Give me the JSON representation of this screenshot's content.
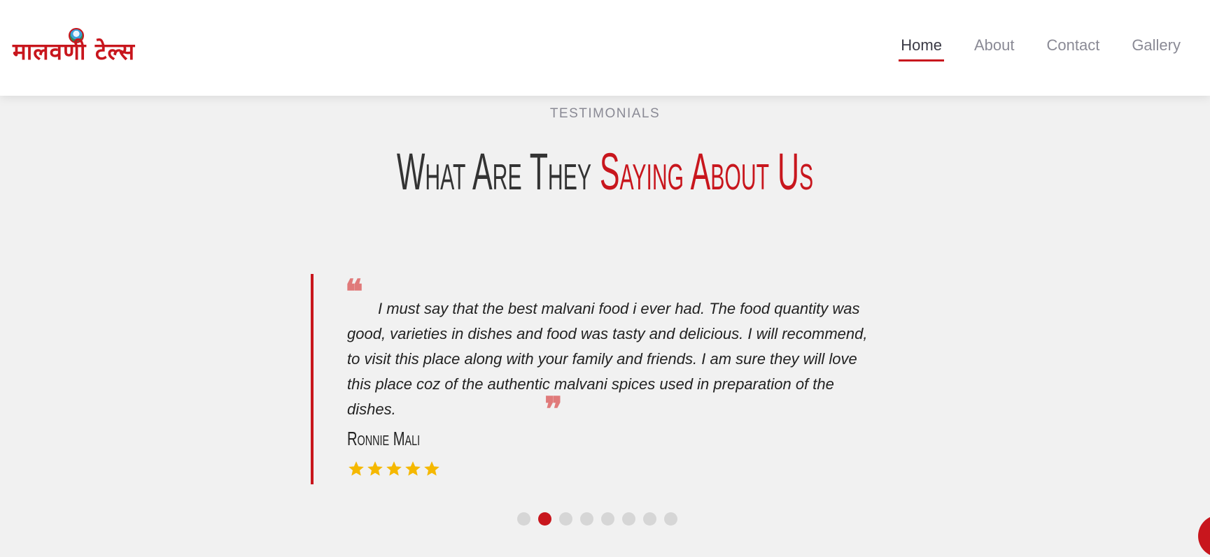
{
  "header": {
    "logo_text": "मालवणी टेल्स",
    "nav": [
      {
        "label": "Home",
        "active": true
      },
      {
        "label": "About",
        "active": false
      },
      {
        "label": "Contact",
        "active": false
      },
      {
        "label": "Gallery",
        "active": false
      }
    ]
  },
  "section": {
    "eyebrow": "TESTIMONIALS",
    "title_part1": "What Are They ",
    "title_part2": "Saying About Us"
  },
  "testimonial": {
    "text": "I must say that the best malvani food i ever had. The food quantity was good, varieties in dishes and food was tasty and delicious. I will recommend, to visit this place along with your family and friends. I am sure they will love this place coz of the authentic malvani spices used in preparation of the dishes.",
    "quote_open": "❝",
    "quote_close": "❞",
    "author": "Ronnie Mali",
    "rating": 5,
    "star_color": "#f5b800"
  },
  "carousel": {
    "total": 8,
    "active_index": 1
  },
  "colors": {
    "accent": "#c8161d",
    "background": "#f1f1f1",
    "quote_mark": "#e07a7a"
  },
  "icons": {
    "quote_open": "quote-open-icon",
    "quote_close": "quote-close-icon",
    "star": "star-icon",
    "fab": "floating-action-button"
  }
}
